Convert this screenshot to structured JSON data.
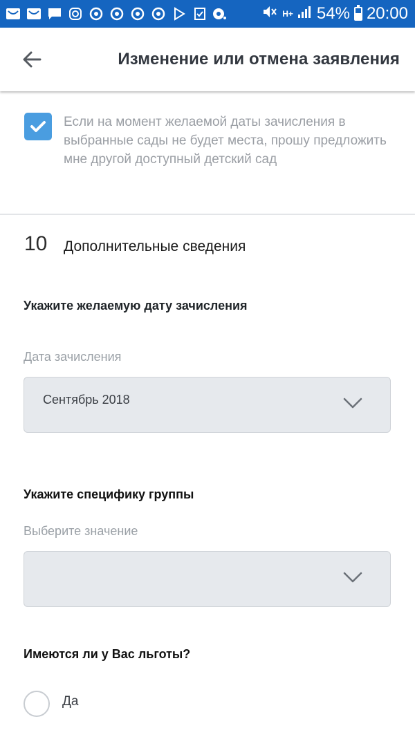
{
  "status_bar": {
    "battery": "54%",
    "time": "20:00",
    "network_badge": "H+",
    "battery_level": 0.54,
    "notification_icons": [
      "mail-icon",
      "mail-icon",
      "chat-icon",
      "instagram-icon",
      "chrome-icon",
      "chrome-icon",
      "chrome-icon",
      "chrome-icon",
      "play-store-icon",
      "checklist-icon",
      "camera-icon"
    ]
  },
  "app_bar": {
    "title": "Изменение или отмена заявления",
    "back_icon": "arrow-left-icon"
  },
  "checkbox": {
    "checked": true,
    "text": "Если на момент желаемой даты зачисления в выбранные сады не будет места, прошу предложить мне другой доступный детский сад"
  },
  "section": {
    "number": "10",
    "title": "Дополнительные сведения"
  },
  "enrollment": {
    "question": "Укажите желаемую дату зачисления",
    "field_label": "Дата зачисления",
    "value": "Сентябрь 2018"
  },
  "group": {
    "question": "Укажите специфику группы",
    "field_label": "Выберите значение",
    "value": ""
  },
  "benefits": {
    "question": "Имеются ли у Вас льготы?",
    "options": [
      {
        "label": "Да",
        "selected": false
      }
    ]
  },
  "colors": {
    "status_bar": "#1565c0",
    "checkbox_accent": "#4a9de0",
    "select_bg": "#e6e9ed"
  }
}
